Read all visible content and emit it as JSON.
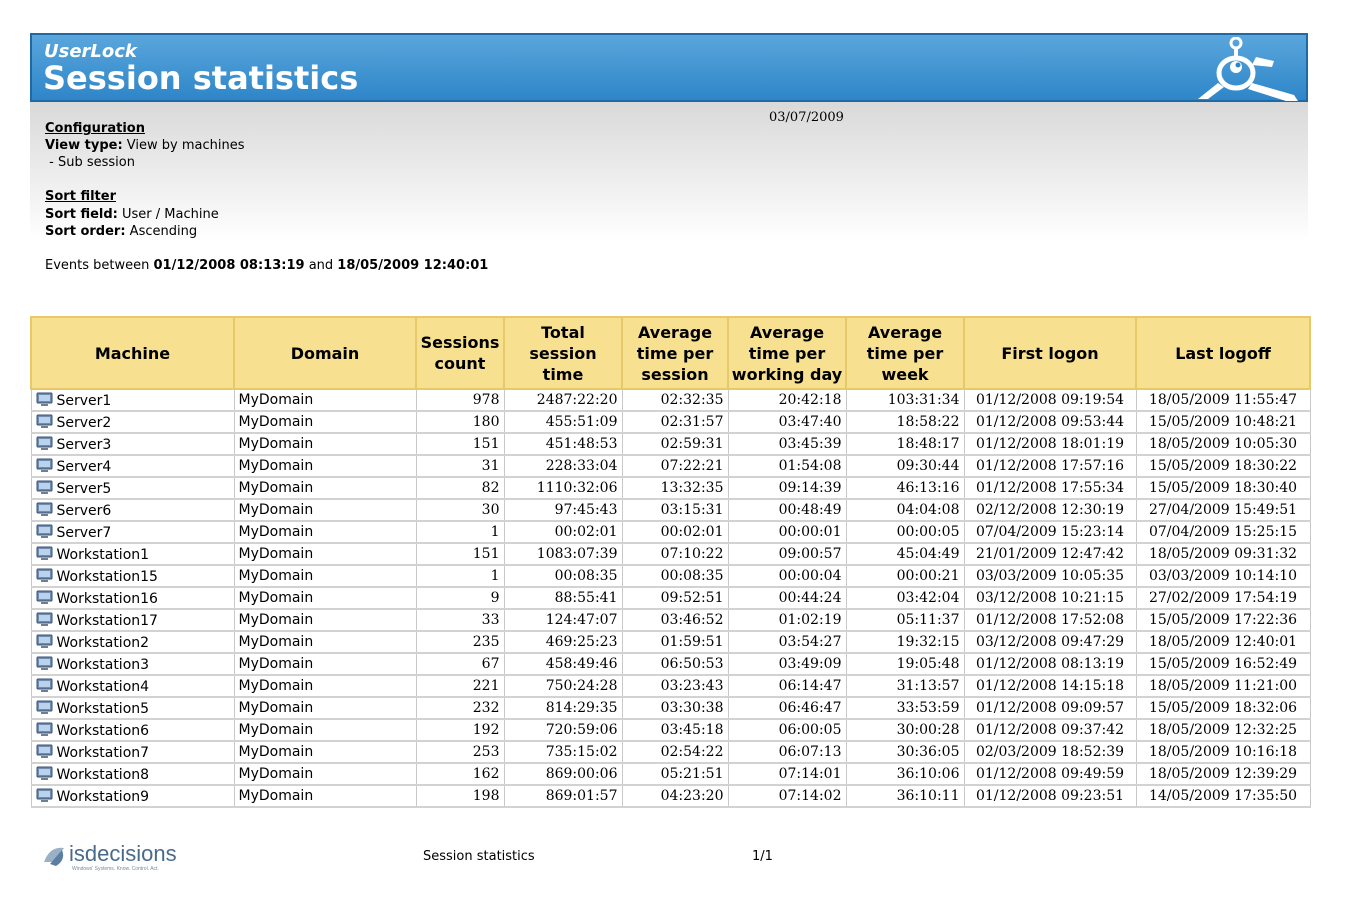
{
  "banner": {
    "app_name": "UserLock",
    "title": "Session statistics"
  },
  "report_date": "03/07/2009",
  "configuration": {
    "heading": "Configuration",
    "view_type_label": "View type:",
    "view_type_value": "View by machines",
    "sub_option": " - Sub session"
  },
  "sort_filter": {
    "heading": "Sort filter",
    "field_label": "Sort field:",
    "field_value": "User / Machine",
    "order_label": "Sort order:",
    "order_value": "Ascending"
  },
  "events": {
    "prefix": "Events between ",
    "start": "01/12/2008 08:13:19",
    "middle": " and ",
    "end": "18/05/2009 12:40:01"
  },
  "table": {
    "headers": [
      "Machine",
      "Domain",
      "Sessions count",
      "Total session time",
      "Average time per session",
      "Average time per working day",
      "Average time per week",
      "First logon",
      "Last logoff"
    ],
    "rows": [
      [
        "Server1",
        "MyDomain",
        "978",
        "2487:22:20",
        "02:32:35",
        "20:42:18",
        "103:31:34",
        "01/12/2008 09:19:54",
        "18/05/2009 11:55:47"
      ],
      [
        "Server2",
        "MyDomain",
        "180",
        "455:51:09",
        "02:31:57",
        "03:47:40",
        "18:58:22",
        "01/12/2008 09:53:44",
        "15/05/2009 10:48:21"
      ],
      [
        "Server3",
        "MyDomain",
        "151",
        "451:48:53",
        "02:59:31",
        "03:45:39",
        "18:48:17",
        "01/12/2008 18:01:19",
        "18/05/2009 10:05:30"
      ],
      [
        "Server4",
        "MyDomain",
        "31",
        "228:33:04",
        "07:22:21",
        "01:54:08",
        "09:30:44",
        "01/12/2008 17:57:16",
        "15/05/2009 18:30:22"
      ],
      [
        "Server5",
        "MyDomain",
        "82",
        "1110:32:06",
        "13:32:35",
        "09:14:39",
        "46:13:16",
        "01/12/2008 17:55:34",
        "15/05/2009 18:30:40"
      ],
      [
        "Server6",
        "MyDomain",
        "30",
        "97:45:43",
        "03:15:31",
        "00:48:49",
        "04:04:08",
        "02/12/2008 12:30:19",
        "27/04/2009 15:49:51"
      ],
      [
        "Server7",
        "MyDomain",
        "1",
        "00:02:01",
        "00:02:01",
        "00:00:01",
        "00:00:05",
        "07/04/2009 15:23:14",
        "07/04/2009 15:25:15"
      ],
      [
        "Workstation1",
        "MyDomain",
        "151",
        "1083:07:39",
        "07:10:22",
        "09:00:57",
        "45:04:49",
        "21/01/2009 12:47:42",
        "18/05/2009 09:31:32"
      ],
      [
        "Workstation15",
        "MyDomain",
        "1",
        "00:08:35",
        "00:08:35",
        "00:00:04",
        "00:00:21",
        "03/03/2009 10:05:35",
        "03/03/2009 10:14:10"
      ],
      [
        "Workstation16",
        "MyDomain",
        "9",
        "88:55:41",
        "09:52:51",
        "00:44:24",
        "03:42:04",
        "03/12/2008 10:21:15",
        "27/02/2009 17:54:19"
      ],
      [
        "Workstation17",
        "MyDomain",
        "33",
        "124:47:07",
        "03:46:52",
        "01:02:19",
        "05:11:37",
        "01/12/2008 17:52:08",
        "15/05/2009 17:22:36"
      ],
      [
        "Workstation2",
        "MyDomain",
        "235",
        "469:25:23",
        "01:59:51",
        "03:54:27",
        "19:32:15",
        "03/12/2008 09:47:29",
        "18/05/2009 12:40:01"
      ],
      [
        "Workstation3",
        "MyDomain",
        "67",
        "458:49:46",
        "06:50:53",
        "03:49:09",
        "19:05:48",
        "01/12/2008 08:13:19",
        "15/05/2009 16:52:49"
      ],
      [
        "Workstation4",
        "MyDomain",
        "221",
        "750:24:28",
        "03:23:43",
        "06:14:47",
        "31:13:57",
        "01/12/2008 14:15:18",
        "18/05/2009 11:21:00"
      ],
      [
        "Workstation5",
        "MyDomain",
        "232",
        "814:29:35",
        "03:30:38",
        "06:46:47",
        "33:53:59",
        "01/12/2008 09:09:57",
        "15/05/2009 18:32:06"
      ],
      [
        "Workstation6",
        "MyDomain",
        "192",
        "720:59:06",
        "03:45:18",
        "06:00:05",
        "30:00:28",
        "01/12/2008 09:37:42",
        "18/05/2009 12:32:25"
      ],
      [
        "Workstation7",
        "MyDomain",
        "253",
        "735:15:02",
        "02:54:22",
        "06:07:13",
        "30:36:05",
        "02/03/2009 18:52:39",
        "18/05/2009 10:16:18"
      ],
      [
        "Workstation8",
        "MyDomain",
        "162",
        "869:00:06",
        "05:21:51",
        "07:14:01",
        "36:10:06",
        "01/12/2008 09:49:59",
        "18/05/2009 12:39:29"
      ],
      [
        "Workstation9",
        "MyDomain",
        "198",
        "869:01:57",
        "04:23:20",
        "07:14:02",
        "36:10:11",
        "01/12/2008 09:23:51",
        "14/05/2009 17:35:50"
      ]
    ]
  },
  "footer": {
    "brand": "isdecisions",
    "tagline": "Windows' Systems. Know. Control. Act.",
    "report_name": "Session statistics",
    "page": "1/1"
  },
  "colors": {
    "banner_blue": "#2e86c8",
    "header_yellow": "#f7e08f"
  },
  "icons": {
    "row_icon": "computer-icon",
    "banner_logo": "userlock-logo-icon"
  }
}
